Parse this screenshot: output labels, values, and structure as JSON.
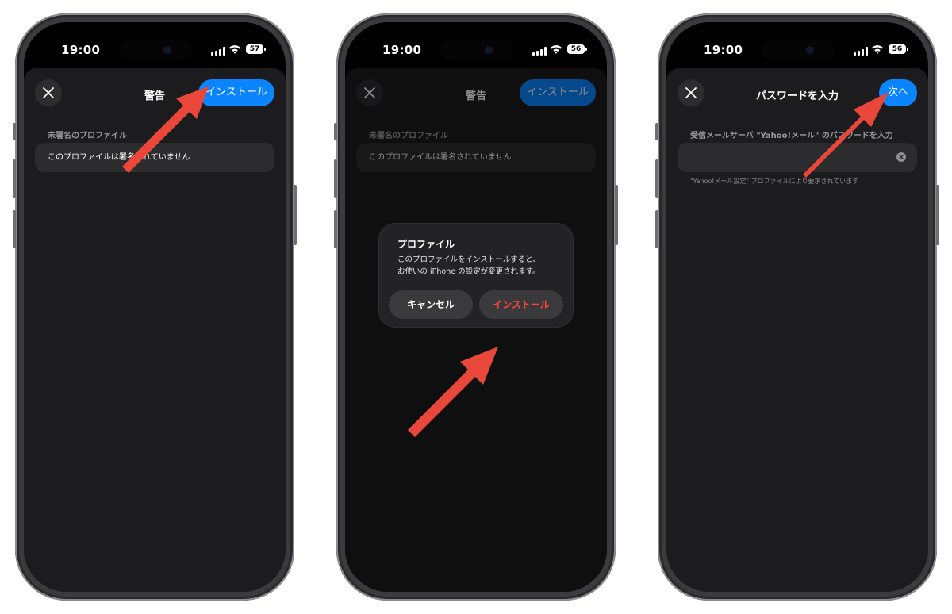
{
  "phones": [
    {
      "status": {
        "time": "19:00",
        "battery": "57"
      },
      "nav": {
        "title": "警告",
        "primary_button": "インストール"
      },
      "section_label": "未署名のプロファイル",
      "field_text": "このプロファイルは署名されていません"
    },
    {
      "status": {
        "time": "19:00",
        "battery": "56"
      },
      "nav": {
        "title": "警告",
        "primary_button": "インストール"
      },
      "section_label": "未署名のプロファイル",
      "field_text": "このプロファイルは署名されていません",
      "alert": {
        "title": "プロファイル",
        "message_line1": "このプロファイルをインストールすると、",
        "message_line2": "お使いの iPhone の設定が変更されます。",
        "cancel": "キャンセル",
        "install": "インストール"
      }
    },
    {
      "status": {
        "time": "19:00",
        "battery": "56"
      },
      "nav": {
        "title": "パスワードを入力",
        "primary_button": "次へ"
      },
      "section_label": "受信メールサーバ \"Yahoo!メール\" のパスワードを入力",
      "field_text": "",
      "footnote": "\"Yahoo!メール設定\" プロファイルにより要求されています"
    }
  ],
  "colors": {
    "accent": "#0a84ff",
    "destructive": "#ff453a",
    "annotation_arrow": "#e8473a",
    "sheet_bg": "#1c1c1e"
  },
  "icons": {
    "close": "close-icon",
    "clear": "clear-text-icon",
    "signal": "cellular-signal-icon",
    "wifi": "wifi-icon",
    "battery": "battery-icon",
    "annotation": "red-arrow-icon"
  }
}
